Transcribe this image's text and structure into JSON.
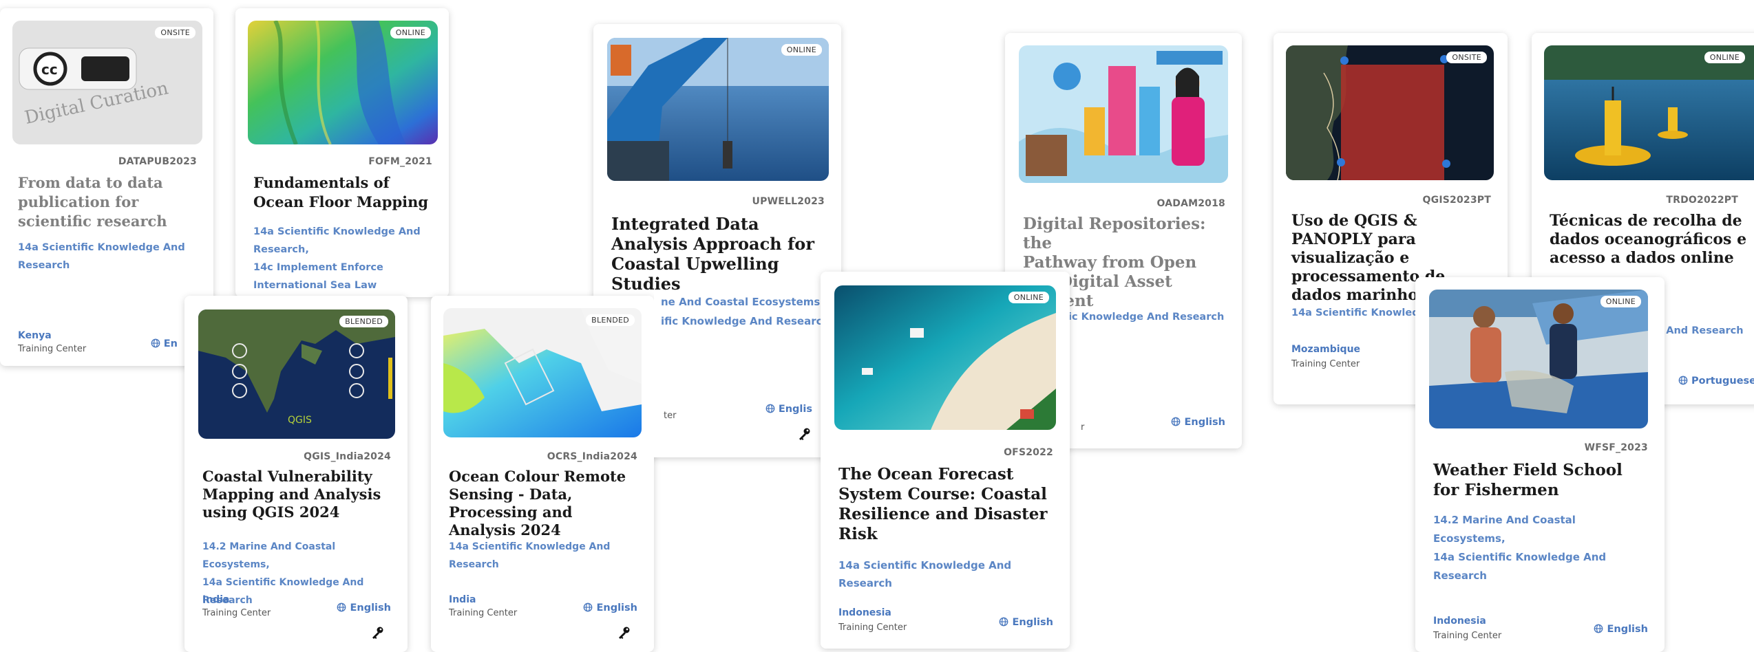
{
  "cards": {
    "datapub": {
      "badge": "ONSITE",
      "code": "DATAPUB2023",
      "title": "From data to data publication for scientific research",
      "tags": [
        "14a Scientific Knowledge And Research"
      ],
      "country": "Kenya",
      "type": "Training Center",
      "language": "En"
    },
    "fofm": {
      "badge": "ONLINE",
      "code": "FOFM_2021",
      "title": "Fundamentals of Ocean Floor Mapping",
      "tags": [
        "14a Scientific Knowledge And Research,",
        "14c Implement Enforce International Sea Law"
      ]
    },
    "upwell": {
      "badge": "ONLINE",
      "code": "UPWELL2023",
      "title": "Integrated Data Analysis Approach for Coastal Upwelling Studies",
      "tags": [
        "ne And Coastal Ecosystems,",
        "ific Knowledge And Researc"
      ],
      "type": "ter",
      "language": "Englis"
    },
    "oadam": {
      "code": "OADAM2018",
      "title_lines": [
        "Digital Repositories: the",
        "Pathway from Open",
        "to Digital Asset",
        "ment"
      ],
      "tags": [
        "ic Knowledge And Research"
      ],
      "type": "r",
      "language": "English"
    },
    "qgispt": {
      "badge": "ONSITE",
      "code": "QGIS2023PT",
      "title": "Uso de QGIS & PANOPLY para visualização e processamento de dados marinhos",
      "tags": [
        "14a Scientific Knowledg"
      ],
      "country": "Mozambique",
      "type": "Training Center"
    },
    "trdo": {
      "badge": "ONLINE",
      "code": "TRDO2022PT",
      "title": "Técnicas de recolha de dados oceanográficos e acesso a dados online",
      "tags": [
        "ge And Research"
      ],
      "language": "Portuguese"
    },
    "qgisindia": {
      "badge": "BLENDED",
      "code": "QGIS_India2024",
      "title": "Coastal Vulnerability Mapping and Analysis using QGIS 2024",
      "tags": [
        "14.2 Marine And Coastal Ecosystems,",
        "14a Scientific Knowledge And Research"
      ],
      "country": "India",
      "type": "Training Center",
      "language": "English",
      "map_text": "QGIS"
    },
    "ocrs": {
      "badge": "BLENDED",
      "code": "OCRS_India2024",
      "title": "Ocean Colour Remote Sensing - Data, Processing and Analysis 2024",
      "tags": [
        "14a Scientific Knowledge And Research"
      ],
      "country": "India",
      "type": "Training Center",
      "language": "English"
    },
    "ofs": {
      "badge": "ONLINE",
      "code": "OFS2022",
      "title": "The Ocean Forecast System Course: Coastal Resilience and Disaster Risk",
      "tags": [
        "14a Scientific Knowledge And Research"
      ],
      "country": "Indonesia",
      "type": "Training Center",
      "language": "English"
    },
    "wfsf": {
      "badge": "ONLINE",
      "code": "WFSF_2023",
      "title": "Weather Field School for Fishermen",
      "tags": [
        "14.2 Marine And Coastal Ecosystems,",
        "14a Scientific Knowledge And Research"
      ],
      "country": "Indonesia",
      "type": "Training Center",
      "language": "English"
    }
  },
  "colors": {
    "link": "#4a78be",
    "tag": "#5b86c5",
    "title": "#1a1a1a",
    "muted": "#808080"
  }
}
